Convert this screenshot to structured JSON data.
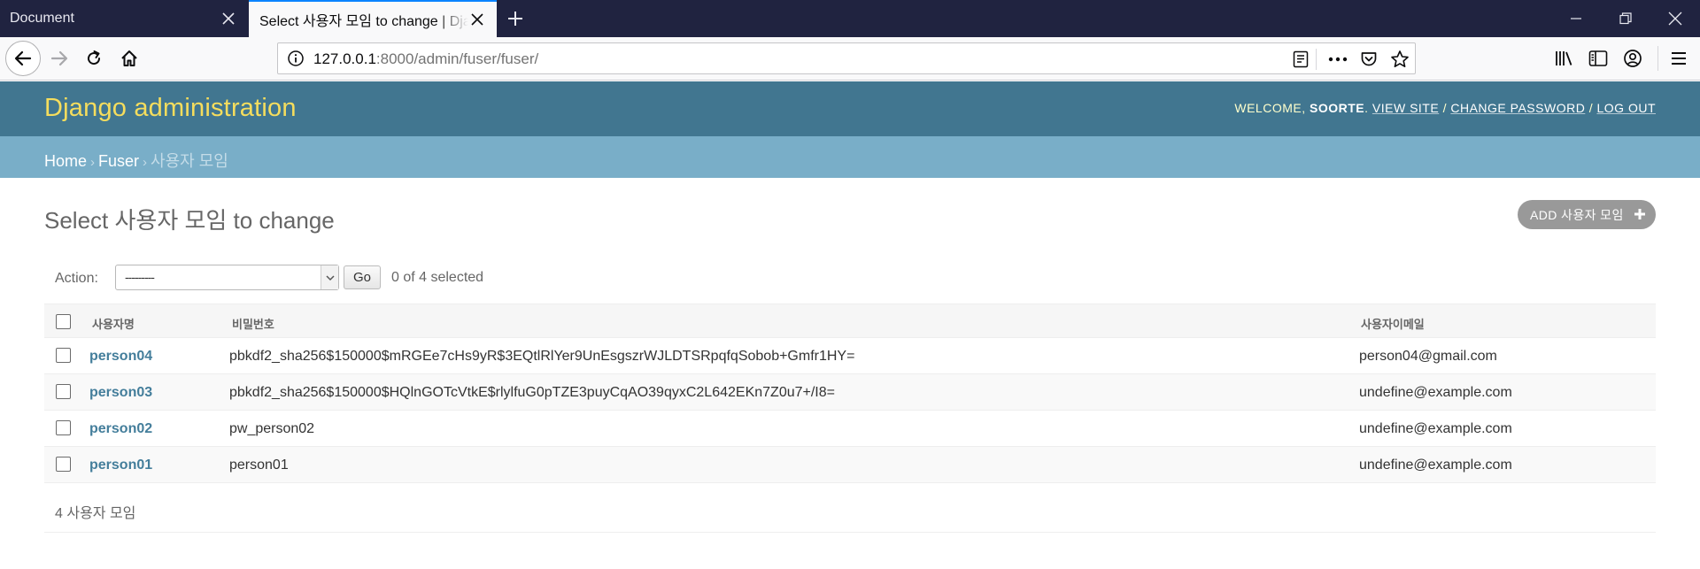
{
  "browser": {
    "tabs": [
      {
        "title": "Document",
        "active": false
      },
      {
        "title": "Select 사용자 모임 to change | Django site admin",
        "active": true
      }
    ],
    "url_host": "127.0.0.1",
    "url_rest": ":8000/admin/fuser/fuser/",
    "accent_color": "#0a84ff"
  },
  "header": {
    "branding": "Django administration",
    "welcome": "WELCOME, ",
    "username": "SOORTE",
    "after_username": ". ",
    "view_site": "VIEW SITE",
    "change_password": "CHANGE PASSWORD",
    "log_out": "LOG OUT",
    "slash": " / ",
    "header_color": "#417690",
    "branding_color": "#f5dd5d"
  },
  "breadcrumbs": {
    "home": "Home",
    "app": "Fuser",
    "current": "사용자 모임",
    "separator": "›",
    "bar_color": "#79aec8"
  },
  "content": {
    "title": "Select 사용자 모임 to change",
    "add_button": "ADD 사용자 모임"
  },
  "actions": {
    "label": "Action:",
    "selected_option": "---------",
    "go": "Go",
    "counter": "0 of 4 selected"
  },
  "table": {
    "columns": [
      "사용자명",
      "비밀번호",
      "사용자이메일"
    ],
    "rows": [
      {
        "username": "person04",
        "password": "pbkdf2_sha256$150000$mRGEe7cHs9yR$3EQtlRlYer9UnEsgszrWJLDTSRpqfqSobob+Gmfr1HY=",
        "email": "person04@gmail.com"
      },
      {
        "username": "person03",
        "password": "pbkdf2_sha256$150000$HQlnGOTcVtkE$rlylfuG0pTZE3puyCqAO39qyxC2L642EKn7Z0u7+/I8=",
        "email": "undefine@example.com"
      },
      {
        "username": "person02",
        "password": "pw_person02",
        "email": "undefine@example.com"
      },
      {
        "username": "person01",
        "password": "person01",
        "email": "undefine@example.com"
      }
    ],
    "link_color": "#447e9b"
  },
  "paginator": {
    "count": "4 사용자 모임"
  }
}
